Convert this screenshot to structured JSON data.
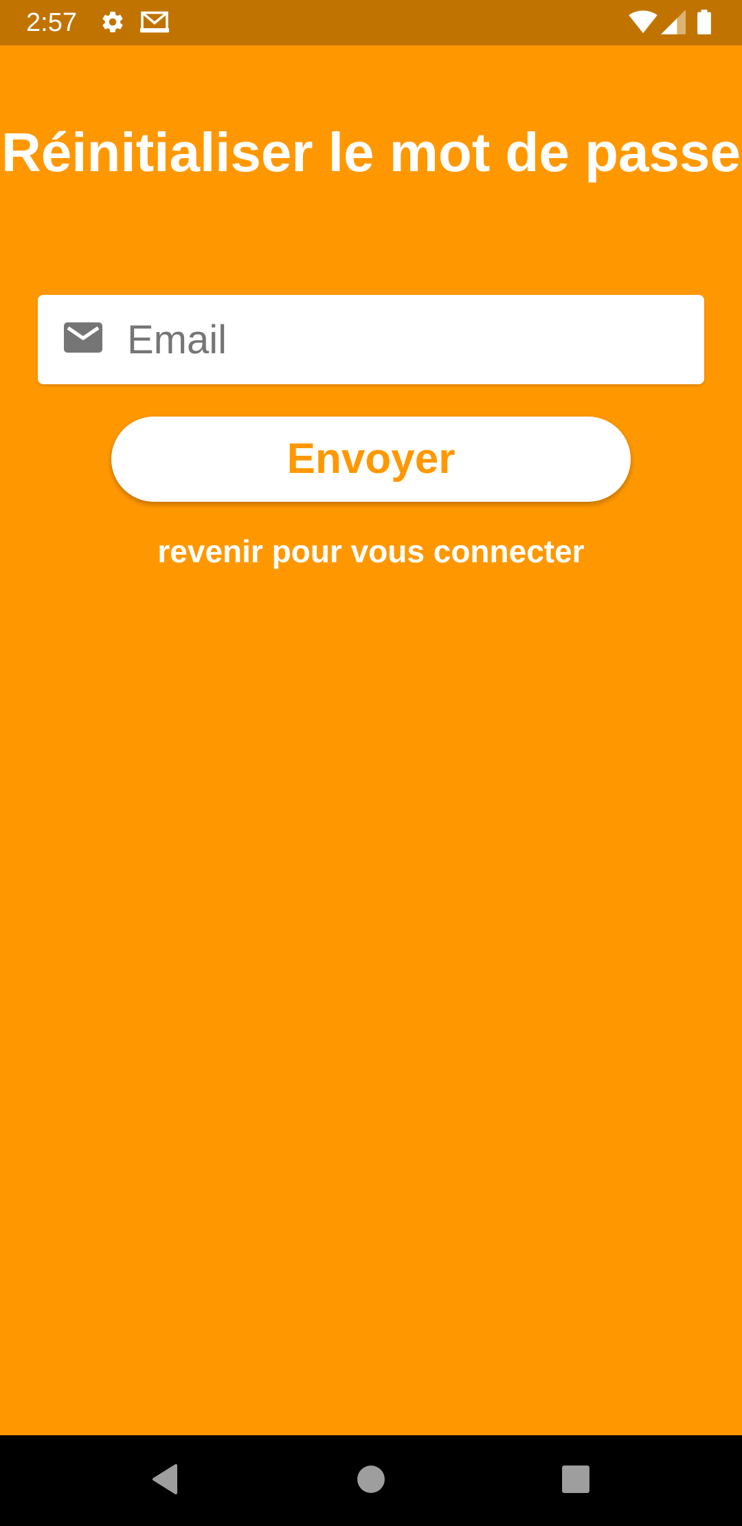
{
  "status_bar": {
    "time": "2:57",
    "icons_left": [
      "gear-icon",
      "gmail-icon"
    ],
    "icons_right": [
      "wifi-icon",
      "cell-signal-icon",
      "battery-icon"
    ]
  },
  "colors": {
    "background": "#FF9800",
    "status_bar": "#C17300",
    "nav_bar": "#000000",
    "button_text": "#FF9800"
  },
  "page": {
    "title": "Réinitialiser le mot de passe",
    "email_field": {
      "placeholder": "Email",
      "value": "",
      "icon": "mail-icon"
    },
    "send_button_label": "Envoyer",
    "back_link_label": "revenir pour vous connecter"
  },
  "nav_bar": {
    "buttons": [
      "back-icon",
      "home-icon",
      "recents-icon"
    ]
  }
}
